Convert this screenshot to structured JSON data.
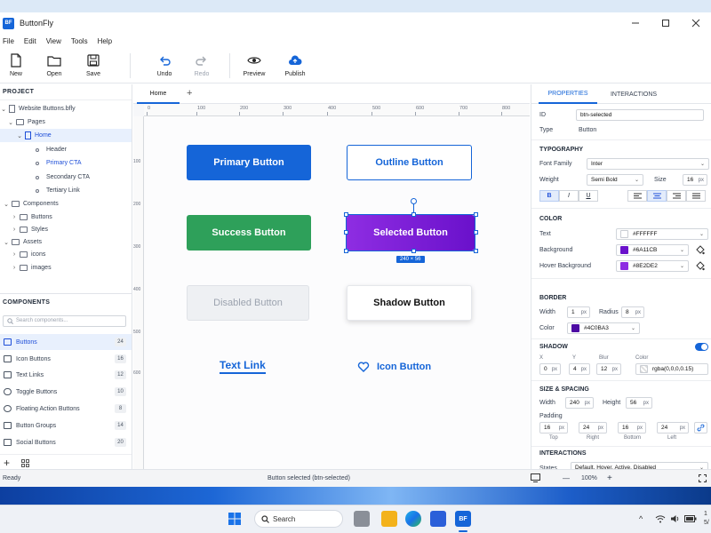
{
  "app": {
    "title": "ButtonFly",
    "logo": "BF"
  },
  "menu": [
    "File",
    "Edit",
    "View",
    "Tools",
    "Help"
  ],
  "toolbar": {
    "new": "New",
    "open": "Open",
    "save": "Save",
    "undo": "Undo",
    "redo": "Redo",
    "preview": "Preview",
    "publish": "Publish"
  },
  "project": {
    "header": "PROJECT",
    "items": [
      {
        "label": "Website Buttons.bfly"
      },
      {
        "label": "Pages"
      },
      {
        "label": "Home"
      },
      {
        "label": "Header"
      },
      {
        "label": "Primary CTA"
      },
      {
        "label": "Secondary CTA"
      },
      {
        "label": "Tertiary Link"
      },
      {
        "label": "Components"
      },
      {
        "label": "Buttons"
      },
      {
        "label": "Styles"
      },
      {
        "label": "Assets"
      },
      {
        "label": "icons"
      },
      {
        "label": "images"
      }
    ]
  },
  "components": {
    "header": "COMPONENTS",
    "search_placeholder": "Search components...",
    "items": [
      {
        "label": "Buttons",
        "count": "24"
      },
      {
        "label": "Icon Buttons",
        "count": "16"
      },
      {
        "label": "Text Links",
        "count": "12"
      },
      {
        "label": "Toggle Buttons",
        "count": "10"
      },
      {
        "label": "Floating Action Buttons",
        "count": "8"
      },
      {
        "label": "Button Groups",
        "count": "14"
      },
      {
        "label": "Social Buttons",
        "count": "20"
      }
    ]
  },
  "canvas": {
    "tab": "Home",
    "hruler": [
      "0",
      "100",
      "200",
      "300",
      "400",
      "500",
      "600",
      "700",
      "800"
    ],
    "vruler": [
      "100",
      "200",
      "300",
      "400",
      "500",
      "600"
    ],
    "buttons": {
      "primary": "Primary Button",
      "outline": "Outline Button",
      "success": "Success Button",
      "selected": "Selected Button",
      "disabled": "Disabled Button",
      "shadow": "Shadow Button",
      "textlink": "Text Link",
      "icon": "Icon Button"
    },
    "size_tag": "240 × 56"
  },
  "props": {
    "tab_properties": "PROPERTIES",
    "tab_interactions": "INTERACTIONS",
    "id_label": "ID",
    "id_value": "btn-selected",
    "type_label": "Type",
    "type_value": "Button",
    "typography": "TYPOGRAPHY",
    "font_family_label": "Font Family",
    "font_family": "Inter",
    "weight_label": "Weight",
    "weight": "Semi Bold",
    "size_label": "Size",
    "size": "16",
    "px": "px",
    "bold": "B",
    "italic": "I",
    "underline": "U",
    "color": "COLOR",
    "text_label": "Text",
    "text_color": "#FFFFFF",
    "bg_label": "Background",
    "bg_color": "#6A11CB",
    "hover_label": "Hover Background",
    "hover_color": "#8E2DE2",
    "border": "BORDER",
    "width_label": "Width",
    "border_width": "1",
    "radius_label": "Radius",
    "radius": "8",
    "bcolor_label": "Color",
    "border_color": "#4C0BA3",
    "shadow": "SHADOW",
    "x_label": "X",
    "y_label": "Y",
    "blur_label": "Blur",
    "scolor_label": "Color",
    "sx": "0",
    "sy": "4",
    "blur": "12",
    "shadow_color": "rgba(0,0,0,0.15)",
    "size_spacing": "SIZE & SPACING",
    "w_label": "Width",
    "w": "240",
    "h_label": "Height",
    "h": "56",
    "padding_label": "Padding",
    "pad_top": "16",
    "pad_right": "24",
    "pad_bottom": "16",
    "pad_left": "24",
    "top": "Top",
    "right": "Right",
    "bottom": "Bottom",
    "left": "Left",
    "interactions": "INTERACTIONS",
    "states_label": "States",
    "states": "Default, Hover, Active, Disabled"
  },
  "status": {
    "left": "Ready",
    "center": "Button selected (btn-selected)",
    "zoom": "100%",
    "minus": "—",
    "plus": "+"
  },
  "taskbar": {
    "search": "Search",
    "app": "BF",
    "clock": "1",
    "date": "5/"
  },
  "colors": {
    "accent": "#1565D8",
    "primary": "#1565D8",
    "success": "#2EA05A",
    "selected_from": "#6A11CB",
    "selected_to": "#8E2DE2"
  }
}
